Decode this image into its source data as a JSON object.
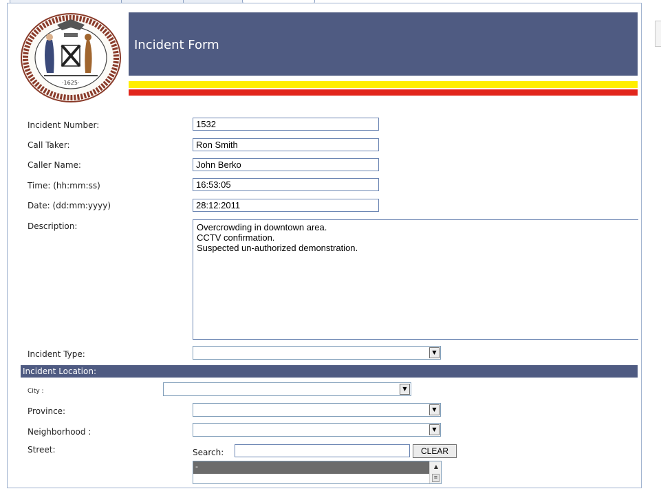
{
  "header": {
    "title": "Incident Form"
  },
  "form": {
    "incident_number": {
      "label": "Incident Number:",
      "value": "1532"
    },
    "call_taker": {
      "label": "Call Taker:",
      "value": "Ron Smith"
    },
    "caller_name": {
      "label": "Caller Name:",
      "value": "John Berko"
    },
    "time": {
      "label": "Time: (hh:mm:ss)",
      "value": "16:53:05"
    },
    "date": {
      "label": "Date: (dd:mm:yyyy)",
      "value": "28:12:2011"
    },
    "description": {
      "label": "Description:",
      "value": "Overcrowding in downtown area.\nCCTV confirmation.\nSuspected un-authorized demonstration."
    },
    "incident_type": {
      "label": "Incident Type:",
      "value": ""
    }
  },
  "location": {
    "section_title": "Incident Location:",
    "city": {
      "label": "City :",
      "value": ""
    },
    "province": {
      "label": "Province:",
      "value": ""
    },
    "neighborhood": {
      "label": "Neighborhood :",
      "value": ""
    },
    "street": {
      "label": "Street:",
      "search_label": "Search:",
      "search_value": "",
      "clear_label": "CLEAR",
      "list_selected": "-"
    }
  },
  "colors": {
    "header_band": "#4f5b82",
    "stripe_yellow": "#ffee00",
    "stripe_red": "#e2261c",
    "section_bar": "#4f5b82"
  }
}
